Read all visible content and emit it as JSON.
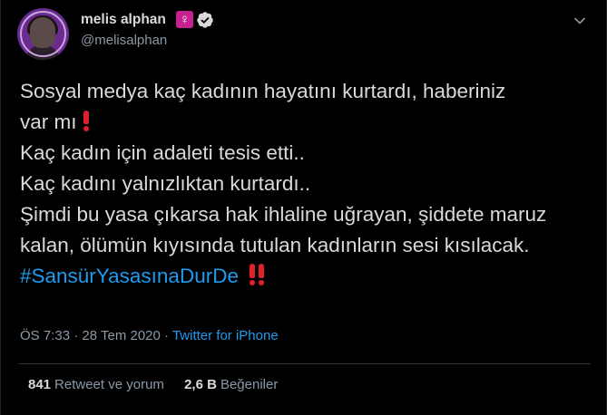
{
  "author": {
    "name": "melis alphan",
    "handle": "@melisalphan",
    "badge_symbol": "♀",
    "badge_color": "#c5218f",
    "verified_icon": "verified-badge-icon",
    "avatar_color": "#6a2a8f"
  },
  "tweet": {
    "line1": "Sosyal medya kaç kadının hayatını kurtardı, haberiniz",
    "line2": "var mı",
    "line3": "Kaç kadın için adaleti tesis etti..",
    "line4": "Kaç kadını yalnızlıktan kurtardı..",
    "line5": "Şimdi bu yasa çıkarsa hak ihlaline uğrayan, şiddete maruz kalan, ölümün kıyısında tutulan kadınların sesi kısılacak.",
    "hashtag": "#SansürYasasınaDurDe",
    "emoji_single": "red-exclamation-icon",
    "emoji_double": "red-double-exclamation-icon"
  },
  "meta": {
    "time": "ÖS 7:33",
    "separator": "·",
    "date": "28 Tem 2020",
    "source": "Twitter for iPhone"
  },
  "stats": {
    "retweets_count": "841",
    "retweets_label": "Retweet ve yorum",
    "likes_count": "2,6 B",
    "likes_label": "Beğeniler"
  },
  "colors": {
    "background": "#000000",
    "text": "#d9d9d9",
    "muted": "#8b98a5",
    "link": "#1d9bf0",
    "emoji_red": "#e0202c",
    "divider": "#2f3336"
  }
}
